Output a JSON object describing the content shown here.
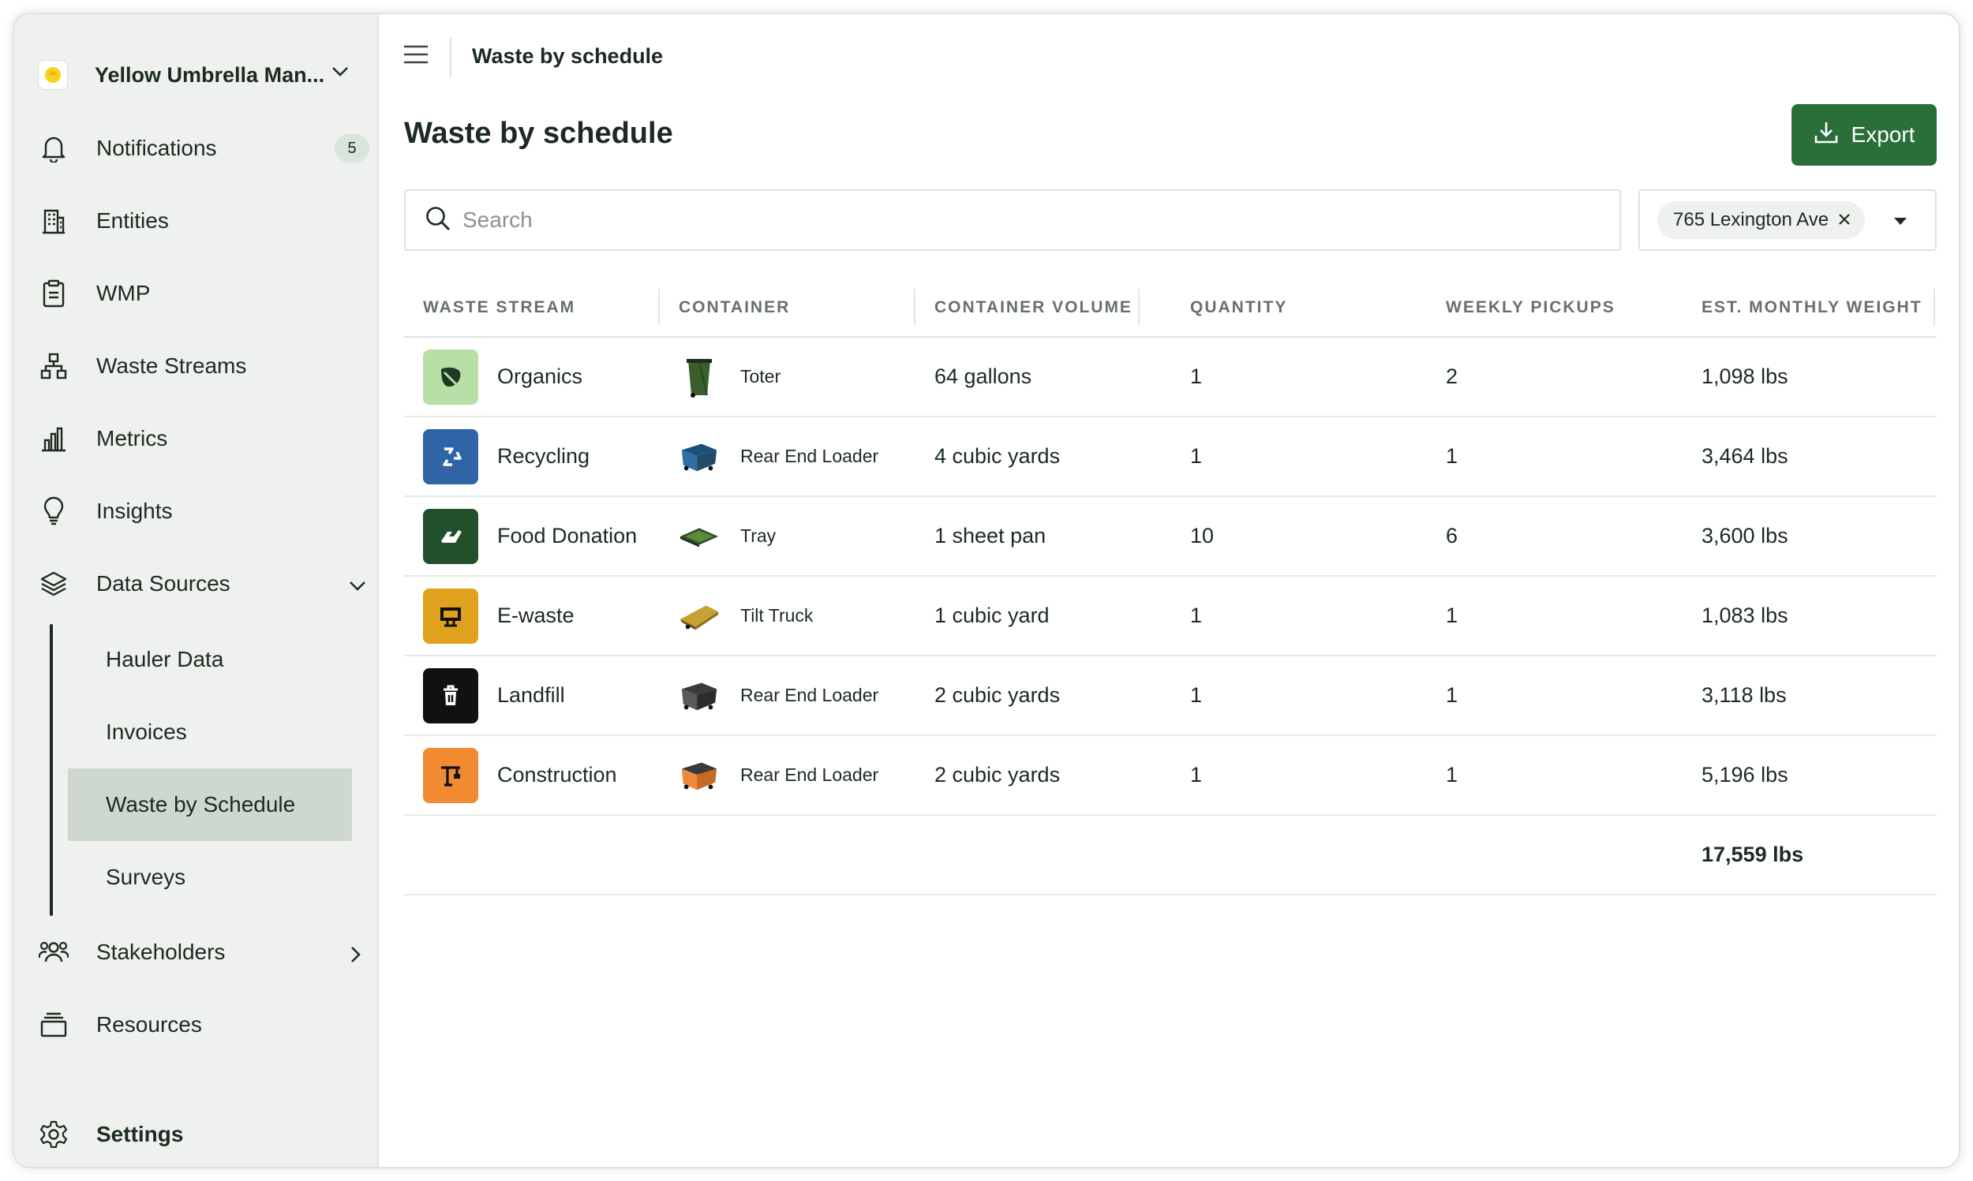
{
  "org": {
    "name": "Yellow Umbrella Man..."
  },
  "nav": {
    "notifications": {
      "label": "Notifications",
      "badge": "5"
    },
    "entities": "Entities",
    "wmp": "WMP",
    "waste_streams": "Waste Streams",
    "metrics": "Metrics",
    "insights": "Insights",
    "data_sources": "Data Sources",
    "sub": [
      "Hauler Data",
      "Invoices",
      "Waste by Schedule",
      "Surveys"
    ],
    "stakeholders": "Stakeholders",
    "resources": "Resources",
    "settings": "Settings"
  },
  "header": {
    "breadcrumb": "Waste by schedule",
    "title": "Waste by schedule",
    "export_label": "Export"
  },
  "search": {
    "placeholder": "Search"
  },
  "filter": {
    "location": "765 Lexington Ave"
  },
  "table": {
    "columns": [
      "WASTE STREAM",
      "CONTAINER",
      "CONTAINER VOLUME",
      "QUANTITY",
      "WEEKLY PICKUPS",
      "EST. MONTHLY WEIGHT"
    ],
    "rows": [
      {
        "stream": "Organics",
        "container": "Toter",
        "volume": "64 gallons",
        "quantity": "1",
        "pickups": "2",
        "weight": "1,098 lbs"
      },
      {
        "stream": "Recycling",
        "container": "Rear End Loader",
        "volume": "4 cubic yards",
        "quantity": "1",
        "pickups": "1",
        "weight": "3,464 lbs"
      },
      {
        "stream": "Food Donation",
        "container": "Tray",
        "volume": "1 sheet pan",
        "quantity": "10",
        "pickups": "6",
        "weight": "3,600 lbs"
      },
      {
        "stream": "E-waste",
        "container": "Tilt Truck",
        "volume": "1 cubic yard",
        "quantity": "1",
        "pickups": "1",
        "weight": "1,083 lbs"
      },
      {
        "stream": "Landfill",
        "container": "Rear End Loader",
        "volume": "2 cubic yards",
        "quantity": "1",
        "pickups": "1",
        "weight": "3,118 lbs"
      },
      {
        "stream": "Construction",
        "container": "Rear End Loader",
        "volume": "2 cubic yards",
        "quantity": "1",
        "pickups": "1",
        "weight": "5,196 lbs"
      }
    ],
    "total_weight": "17,559 lbs"
  },
  "colors": {
    "accent": "#2a6e3a",
    "organics": "#b8dfa6",
    "recycling": "#2f64a6",
    "food_donation": "#22502c",
    "e_waste": "#e0a11c",
    "landfill": "#111111",
    "construction": "#f28a32"
  }
}
